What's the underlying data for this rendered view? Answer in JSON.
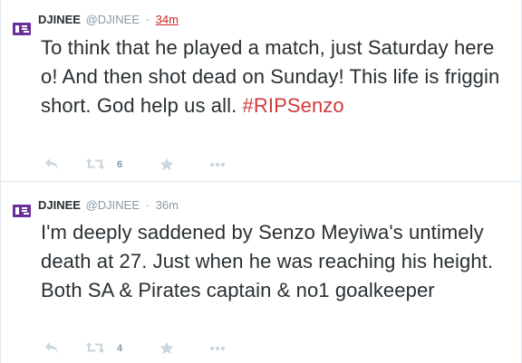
{
  "tweets": [
    {
      "fullname": "DJINEE",
      "username": "@DJINEE",
      "separator": "·",
      "time": "34m",
      "text_main": "To think that he played a match, just Saturday here o! And then shot dead on Sunday! This life is friggin short. God help us all. ",
      "hashtag": "#RIPSenzo",
      "retweet_count": "6",
      "time_highlighted": true
    },
    {
      "fullname": "DJINEE",
      "username": "@DJINEE",
      "separator": "·",
      "time": "36m",
      "text_main": "I'm deeply saddened by Senzo Meyiwa's untimely death at 27. Just when he was reaching his height. Both SA & Pirates captain & no1 goalkeeper",
      "hashtag": "",
      "retweet_count": "4",
      "time_highlighted": false
    }
  ],
  "icons": {
    "reply": "reply-icon",
    "retweet": "retweet-icon",
    "favorite": "star-icon",
    "more": "more-icon"
  },
  "colors": {
    "hashtag": "#d13a3a",
    "icon": "#ccd6dd",
    "muted": "#8899a6",
    "text": "#292f33",
    "avatar": "#6b2f9b"
  }
}
